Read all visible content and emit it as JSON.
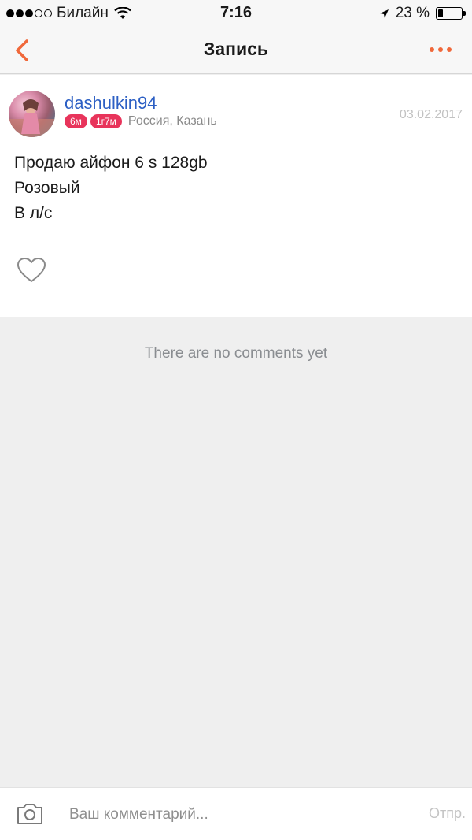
{
  "status_bar": {
    "carrier": "Билайн",
    "time": "7:16",
    "battery_percent": "23 %",
    "battery_level": 0.23
  },
  "nav": {
    "title": "Запись",
    "back_icon": "chevron-left-icon",
    "more_icon": "more-horizontal-icon",
    "accent_color": "#f0683a"
  },
  "post": {
    "author": "dashulkin94",
    "badges": [
      "6м",
      "1г7м"
    ],
    "location": "Россия, Казань",
    "date": "03.02.2017",
    "text_lines": [
      "Продаю айфон 6 s 128gb",
      "Розовый",
      "В л/с"
    ],
    "like_icon": "heart-outline-icon"
  },
  "comments": {
    "empty_message": "There are no comments yet"
  },
  "comment_bar": {
    "placeholder": "Ваш комментарий...",
    "send_label": "Отпр.",
    "camera_icon": "camera-icon"
  }
}
